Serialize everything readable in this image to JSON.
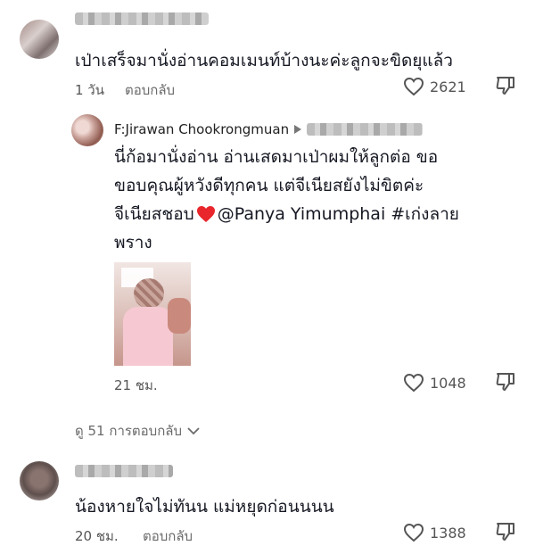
{
  "comments": [
    {
      "text": "เป่าเสร็จมานั่งอ่านคอมเมนท์บ้างนะค่ะลูกจะขิดยุแล้ว",
      "time": "1 วัน",
      "reply_label": "ตอบกลับ",
      "likes": "2621"
    },
    {
      "text": "น้องหายใจไม่ทันน แม่หยุดก่อนนนน",
      "time": "20 ชม.",
      "reply_label": "ตอบกลับ",
      "likes": "1388"
    }
  ],
  "reply": {
    "author": "F:Jirawan Chookrongmuan",
    "text_lines": [
      "นี่ก้อมานั่งอ่าน อ่านเสดมาเป่าผมให้ลูกต่อ ขอ",
      "ขอบคุณผู้หวังดีทุกคน แต่จีเนียสยังไม่ขิตค่ะ",
      "จีเนียสชอบ",
      "@Panya Yimumphai #เก่งลาย",
      "พราง"
    ],
    "time": "21 ชม.",
    "likes": "1048"
  },
  "view_replies": "ดู 51 การตอบกลับ",
  "icons": {
    "heart": "heart-outline-icon",
    "dislike": "thumbs-down-outline-icon",
    "expand": "chevron-down-icon",
    "arrow": "play-arrow-icon",
    "emoji": "red-heart-emoji-icon"
  },
  "colors": {
    "text": "#161823",
    "secondary": "#555555",
    "heart_red": "#e8262b"
  }
}
